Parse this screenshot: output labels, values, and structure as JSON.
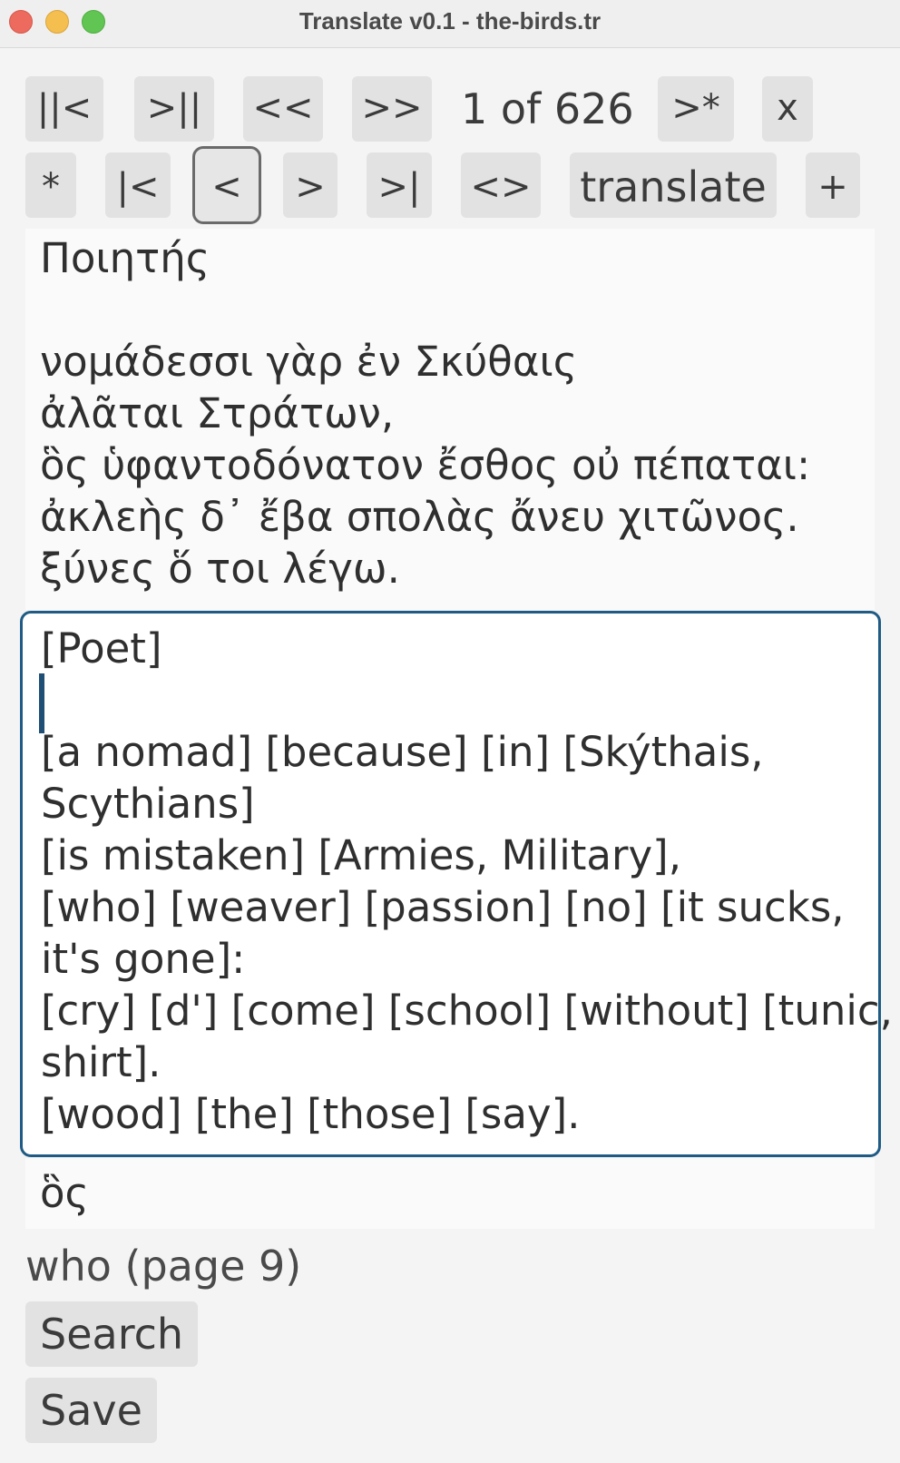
{
  "window": {
    "title": "Translate v0.1 - the-birds.tr"
  },
  "toolbar_row1": {
    "first": "||<",
    "last": ">||",
    "prev_page": "<<",
    "next_page": ">>",
    "page_counter": "1 of 626",
    "next_untranslated": ">*",
    "close": "x"
  },
  "toolbar_row2": {
    "star": "*",
    "word_first": "|<",
    "word_prev": "<",
    "word_next": ">",
    "word_last": ">|",
    "swap": "<>",
    "translate": "translate",
    "add": "+"
  },
  "source_text": {
    "lines": [
      "Ποιητής",
      "",
      "νομάδεσσι γὰρ ἐν Σκύθαις",
      "ἀλᾶται Στράτων,",
      "ὃς ὑφαντοδόνατον ἔσθος οὐ πέπαται:",
      "ἀκλεὴς δ᾽ ἔβα σπολὰς ἄνευ χιτῶνος.",
      "ξύνες ὅ τοι λέγω."
    ]
  },
  "translation_text": {
    "lines": [
      "[Poet]",
      "",
      "[a nomad] [because] [in] [Skýthais,",
      "Scythians]",
      "[is mistaken] [Armies, Military],",
      "[who] [weaver] [passion] [no] [it sucks,",
      "it's gone]:",
      "[cry] [d'] [come] [school] [without] [tunic,",
      "shirt].",
      "[wood] [the] [those] [say]."
    ]
  },
  "lookup": {
    "word": "ὃς",
    "gloss": "who (page 9)"
  },
  "actions": {
    "search": "Search",
    "save": "Save"
  },
  "colors": {
    "focus_border": "#1f5b84",
    "button_bg": "#e2e2e2"
  }
}
